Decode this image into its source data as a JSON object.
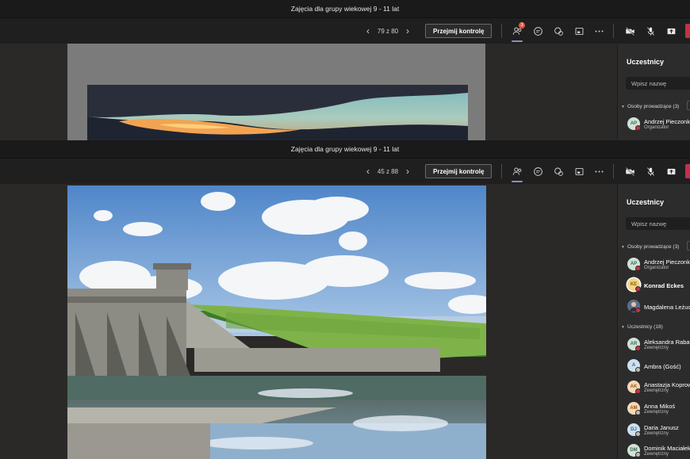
{
  "window_top": {
    "title": "Zajęcia dla grupy wiekowej 9 - 11 lat",
    "page_counter": "79 z 80",
    "take_control": "Przejmij kontrolę",
    "participants_badge": "3",
    "panel": {
      "title": "Uczestnicy",
      "search_placeholder": "Wpisz nazwę",
      "presenters_header": "Osoby prowadzące (3)",
      "people": [
        {
          "initials": "AP",
          "name": "Andrzej Pieczonka",
          "role": "Organizator"
        }
      ]
    }
  },
  "window_bottom": {
    "title": "Zajęcia dla grupy wiekowej 9 - 11 lat",
    "page_counter": "45 z 88",
    "take_control": "Przejmij kontrolę",
    "panel": {
      "title": "Uczestnicy",
      "search_placeholder": "Wpisz nazwę",
      "presenters_header": "Osoby prowadzące (3)",
      "presenters": [
        {
          "initials": "AP",
          "name": "Andrzej Pieczonka",
          "role": "Organizator"
        },
        {
          "initials": "KE",
          "name": "Konrad Eckes",
          "role": ""
        },
        {
          "initials": "",
          "name": "Magdalena Leżuch",
          "role": ""
        }
      ],
      "attendees_header": "Uczestnicy (18)",
      "attendees": [
        {
          "initials": "AR",
          "name": "Aleksandra Raba",
          "role": "Zewnętrzny"
        },
        {
          "initials": "A",
          "name": "Ambra (Gość)",
          "role": ""
        },
        {
          "initials": "AK",
          "name": "Anastazja Koprowska",
          "role": "Zewnętrzny"
        },
        {
          "initials": "AM",
          "name": "Anna Mikoś",
          "role": "Zewnętrzny"
        },
        {
          "initials": "DJ",
          "name": "Daria Janusz",
          "role": "Zewnętrzny"
        },
        {
          "initials": "DM",
          "name": "Dominik Maciałek",
          "role": "Zewnętrzny"
        }
      ]
    }
  },
  "colors": {
    "accent": "#8b8cc7",
    "leave": "#c4314b",
    "badge": "#e3553b",
    "presence_busy": "#c4314b",
    "presence_away": "#bdbdbd"
  },
  "icons": [
    "chevron-left-icon",
    "chevron-right-icon",
    "people-icon",
    "chat-icon",
    "reactions-icon",
    "share-tray-icon",
    "more-icon",
    "camera-off-icon",
    "mic-off-icon",
    "share-icon"
  ]
}
